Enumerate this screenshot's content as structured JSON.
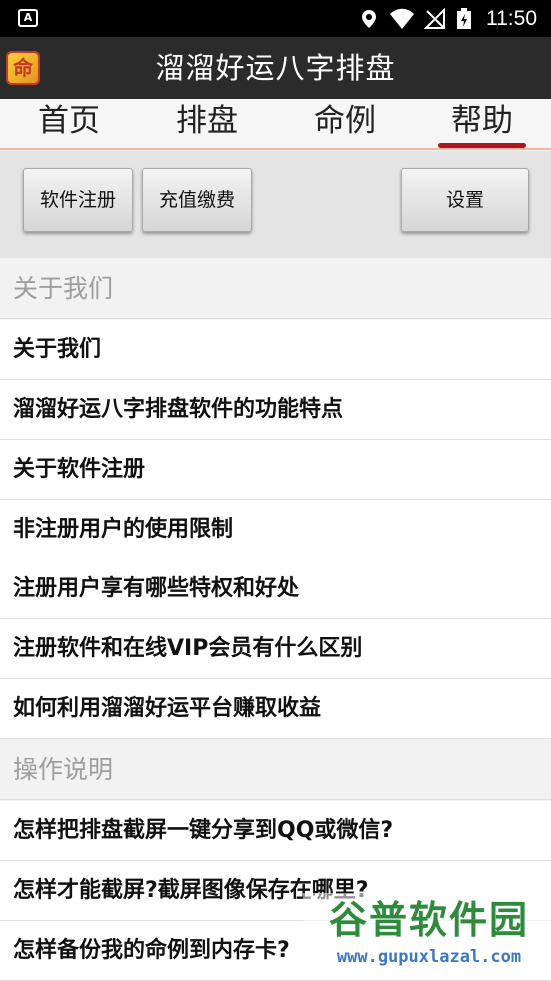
{
  "status_bar": {
    "app_icon_letter": "A",
    "time": "11:50",
    "icons": [
      "location-icon",
      "wifi-icon",
      "signal-icon",
      "battery-icon"
    ]
  },
  "title_bar": {
    "logo_char": "命",
    "title": "溜溜好运八字排盘"
  },
  "tabs": [
    {
      "label": "首页"
    },
    {
      "label": "排盘"
    },
    {
      "label": "命例"
    },
    {
      "label": "帮助"
    }
  ],
  "active_tab": "帮助",
  "buttons": {
    "register": "软件注册",
    "recharge": "充值缴费",
    "settings": "设置"
  },
  "sections": [
    {
      "header": "关于我们",
      "items": [
        "关于我们",
        "溜溜好运八字排盘软件的功能特点",
        "关于软件注册",
        "非注册用户的使用限制",
        "注册用户享有哪些特权和好处",
        "注册软件和在线VIP会员有什么区别",
        "如何利用溜溜好运平台赚取收益"
      ]
    },
    {
      "header": "操作说明",
      "items": [
        "怎样把排盘截屏一键分享到QQ或微信?",
        "怎样才能截屏?截屏图像保存在哪里?",
        "怎样备份我的命例到内存卡?"
      ]
    }
  ],
  "watermark": {
    "title": "谷普软件园",
    "url": "www.gupuxlazal.com"
  },
  "colors": {
    "title_bar": "#2b2b2b",
    "active_tab_underline": "#b0141c",
    "section_header_text": "#9e9e9e"
  }
}
